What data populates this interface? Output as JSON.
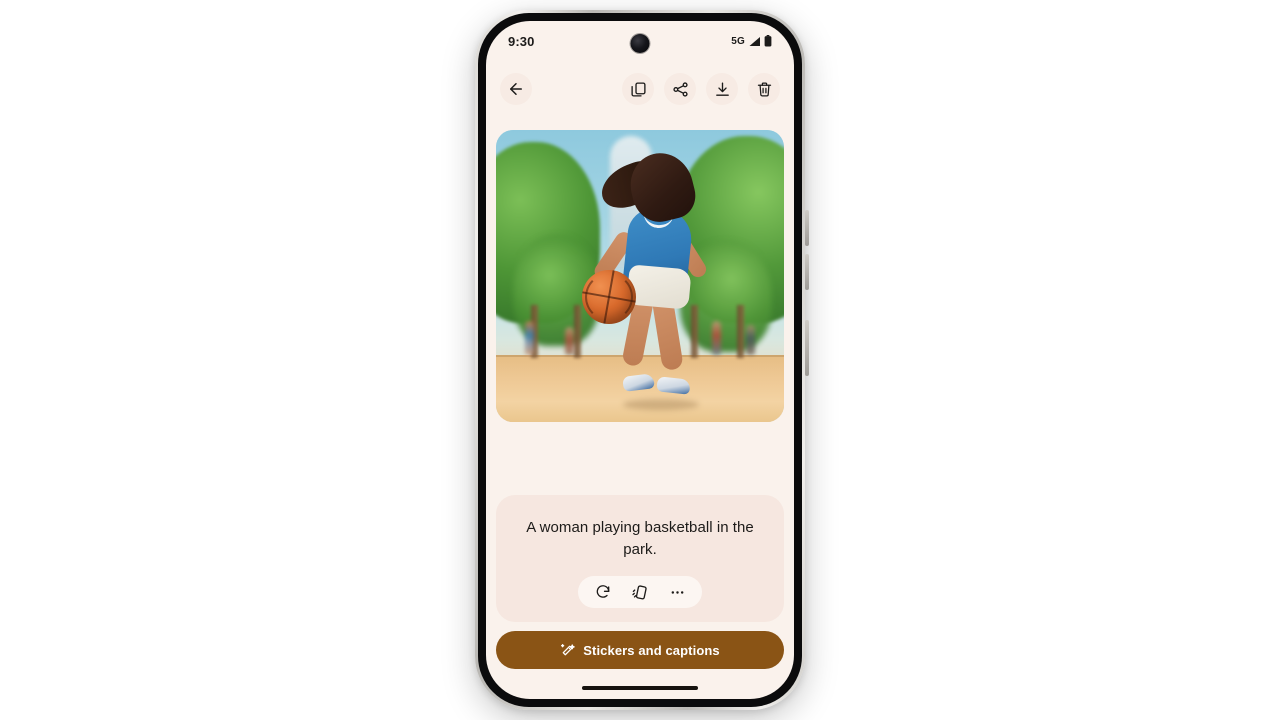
{
  "device": {
    "status_bar": {
      "time": "9:30",
      "network_label": "5G",
      "signal_icon": "cellular-signal-icon",
      "battery_icon": "battery-full-icon",
      "camera_icon": "front-camera-punch-hole"
    },
    "nav_gesture_bar": "home-gesture-pill"
  },
  "app_bar": {
    "back_label": "Back",
    "back_icon": "arrow-left-icon",
    "actions": [
      {
        "id": "copy",
        "label": "Copy",
        "icon": "copy-icon"
      },
      {
        "id": "share",
        "label": "Share",
        "icon": "share-icon"
      },
      {
        "id": "download",
        "label": "Download",
        "icon": "download-icon"
      },
      {
        "id": "delete",
        "label": "Delete",
        "icon": "trash-icon"
      }
    ]
  },
  "main": {
    "image": {
      "alt": "Illustration of a woman dribbling a basketball on a park court",
      "subject": "woman playing basketball",
      "setting": "tree-lined park court"
    },
    "caption": {
      "text": "A woman playing basketball in the park.",
      "actions": [
        {
          "id": "regenerate",
          "label": "Regenerate",
          "icon": "refresh-icon"
        },
        {
          "id": "shake",
          "label": "Shake to change",
          "icon": "shake-device-icon"
        },
        {
          "id": "more",
          "label": "More options",
          "icon": "more-horizontal-icon"
        }
      ]
    },
    "cta": {
      "label": "Stickers and captions",
      "icon": "magic-wand-icon"
    }
  },
  "colors": {
    "app_background": "#faf2ec",
    "caption_card": "#f6e7e0",
    "icon_chip": "#f7ebe4",
    "caption_actions_pill": "#fcf6f2",
    "cta_background": "#8a5415",
    "cta_text": "#ffffff",
    "text_primary": "#1d1b19",
    "page_background": "#ffffff"
  }
}
